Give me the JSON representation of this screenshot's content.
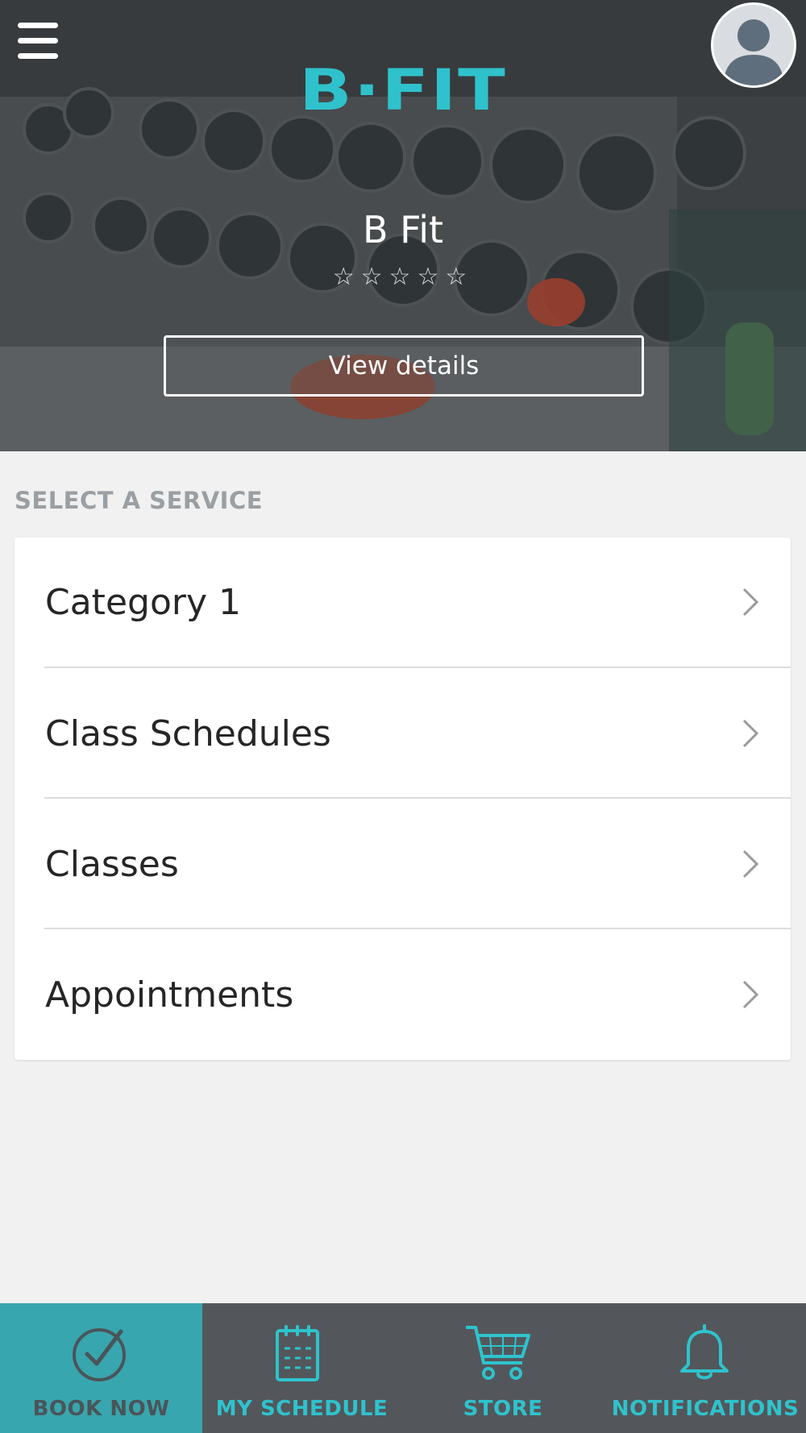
{
  "header": {
    "menu_icon": "hamburger-menu-icon",
    "avatar_icon": "user-avatar-icon",
    "logo_text": "B·FIT",
    "studio_name": "B Fit",
    "rating": {
      "value": 0,
      "max": 5
    },
    "view_details_label": "View details"
  },
  "services": {
    "section_title": "SELECT A SERVICE",
    "items": [
      {
        "label": "Category 1",
        "icon": "chevron-right-icon"
      },
      {
        "label": "Class Schedules",
        "icon": "chevron-right-icon"
      },
      {
        "label": "Classes",
        "icon": "chevron-right-icon"
      },
      {
        "label": "Appointments",
        "icon": "chevron-right-icon"
      }
    ]
  },
  "bottom_nav": {
    "items": [
      {
        "label": "BOOK NOW",
        "icon": "check-circle-icon",
        "active": true
      },
      {
        "label": "MY SCHEDULE",
        "icon": "calendar-icon",
        "active": false
      },
      {
        "label": "STORE",
        "icon": "shopping-cart-icon",
        "active": false
      },
      {
        "label": "NOTIFICATIONS",
        "icon": "bell-icon",
        "active": false
      }
    ]
  },
  "colors": {
    "accent": "#2fc2cc",
    "active_tab_bg": "#38a6ae",
    "nav_bg": "#53575b",
    "page_bg": "#f1f1f1"
  }
}
